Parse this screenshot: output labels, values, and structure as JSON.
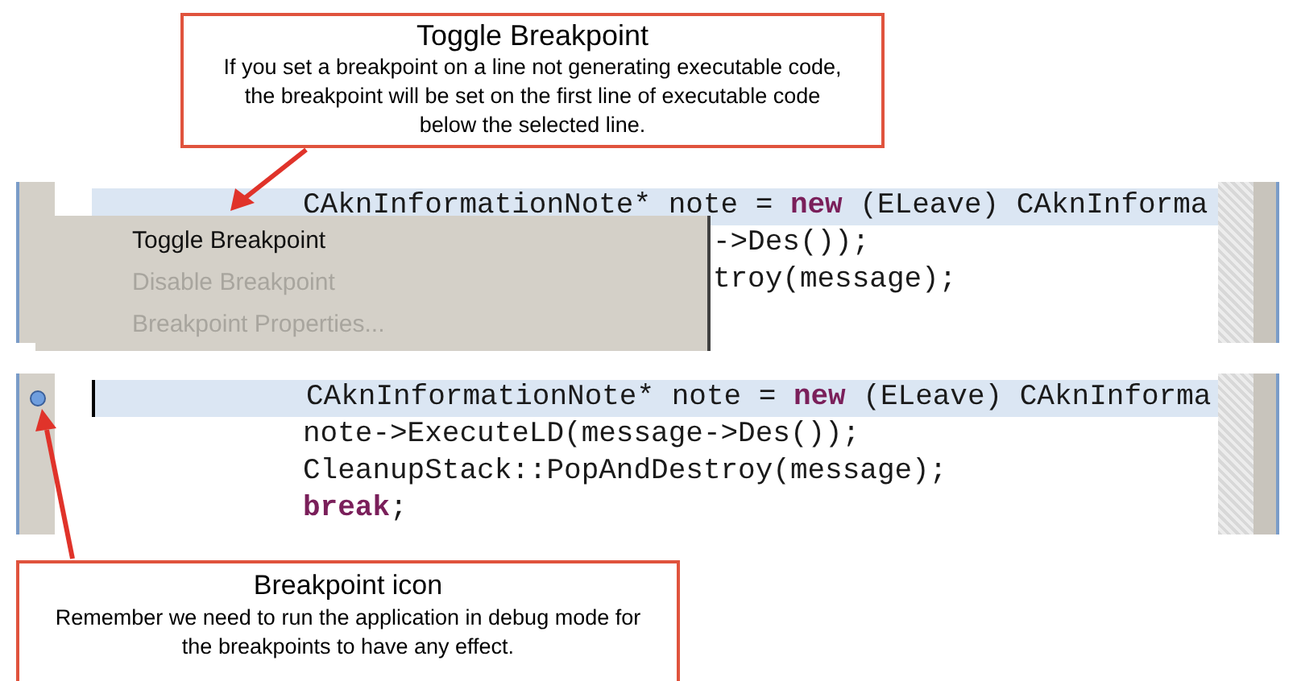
{
  "callouts": [
    {
      "title": "Toggle Breakpoint",
      "body": "If you set a breakpoint on a line not generating executable code, the breakpoint will be set on the first line of executable code below the selected line."
    },
    {
      "title": "Breakpoint icon",
      "body": "Remember we need to run the application in debug mode for the breakpoints to have any effect."
    }
  ],
  "editors": [
    {
      "breakpoint": false,
      "lines": [
        {
          "kind": "full",
          "tokens": [
            {
              "text": "CAknInformationNote* note = ",
              "kind": "plain"
            },
            {
              "text": "new",
              "kind": "keyword"
            },
            {
              "text": " (ELeave) CAknInforma",
              "kind": "plain"
            }
          ]
        },
        {
          "kind": "covered",
          "tokens": [
            {
              "text": "->Des());",
              "kind": "plain"
            }
          ]
        },
        {
          "kind": "covered",
          "tokens": [
            {
              "text": "troy(message);",
              "kind": "plain"
            }
          ]
        }
      ]
    },
    {
      "breakpoint": true,
      "lines": [
        {
          "kind": "full",
          "tokens": [
            {
              "text": "CAknInformationNote* note = ",
              "kind": "plain"
            },
            {
              "text": "new",
              "kind": "keyword"
            },
            {
              "text": " (ELeave) CAknInforma",
              "kind": "plain"
            }
          ]
        },
        {
          "kind": "full",
          "tokens": [
            {
              "text": "note->ExecuteLD(message->Des());",
              "kind": "plain"
            }
          ]
        },
        {
          "kind": "full",
          "tokens": [
            {
              "text": "CleanupStack::PopAndDestroy(message);",
              "kind": "plain"
            }
          ]
        },
        {
          "kind": "full",
          "tokens": [
            {
              "text": "break",
              "kind": "keyword"
            },
            {
              "text": ";",
              "kind": "plain"
            }
          ]
        }
      ]
    }
  ],
  "context_menu": {
    "items": [
      {
        "label": "Toggle Breakpoint",
        "disabled": false
      },
      {
        "label": "Disable Breakpoint",
        "disabled": true
      },
      {
        "label": "Breakpoint Properties...",
        "disabled": true
      }
    ]
  }
}
